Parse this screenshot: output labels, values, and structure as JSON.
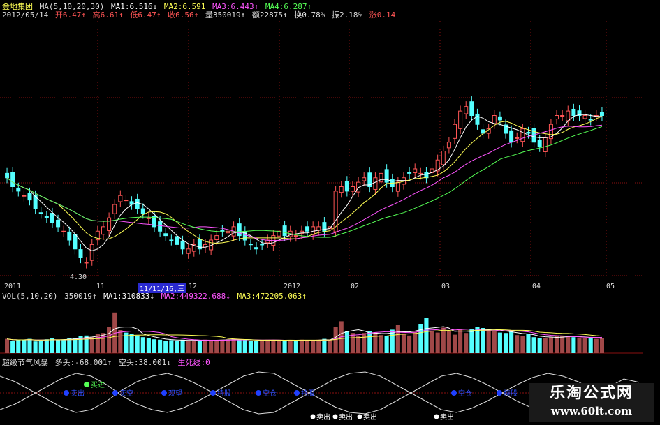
{
  "header": {
    "stock_name": "金地集团",
    "ma_label": "MA(5,10,20,30)",
    "ma1": "MA1:6.516↓",
    "ma2": "MA2:6.591",
    "ma3": "MA3:6.443↑",
    "ma4": "MA4:6.287↑",
    "date": "2012/05/14",
    "open": "开6.47↑",
    "high": "高6.61↑",
    "low": "低6.47↑",
    "close": "收6.56↑",
    "volume": "量350019↑",
    "amount": "额22875↑",
    "turnover": "换0.78%",
    "amplitude": "振2.18%",
    "change": "涨0.14"
  },
  "volume_header": {
    "label": "VOL(5,10,20)",
    "value": "350019↑",
    "ma1": "MA1:310833↓",
    "ma2": "MA2:449322.688↓",
    "ma3": "MA3:472205.063↑"
  },
  "indicator_header": {
    "name": "超级节气风暴",
    "long": "多头:-68.001↑",
    "short": "空头:38.001↓",
    "signal": "生死线:0"
  },
  "x_axis": {
    "labels": [
      "2011",
      "11",
      "11/11/16,三",
      "12",
      "2012",
      "02",
      "03",
      "04",
      "05"
    ]
  },
  "low_marker": "4.30",
  "signals": {
    "buy": [
      "买进"
    ],
    "sell": [
      "卖出",
      "卖出",
      "卖出",
      "卖出"
    ],
    "other": [
      "卖出",
      "卖空",
      "观望",
      "持股",
      "空仓",
      "持股",
      "空仓",
      "持股",
      "观望"
    ]
  },
  "watermark": {
    "line1": "乐淘公式网",
    "line2": "www.60lt.com"
  },
  "colors": {
    "up": "#ff5555",
    "down": "#54ffff",
    "ma1": "#ffffff",
    "ma2": "#ffff55",
    "ma3": "#ff55ff",
    "ma4": "#55ff55",
    "grid": "#8a1010"
  },
  "chart_data": [
    {
      "type": "candlestick",
      "title": "金地集团",
      "ylim": [
        4.0,
        8.0
      ],
      "close": [
        6.2,
        6.0,
        5.9,
        5.8,
        5.7,
        5.5,
        5.4,
        5.3,
        5.2,
        5.1,
        5.0,
        4.8,
        4.6,
        4.4,
        4.3,
        4.7,
        5.0,
        5.1,
        5.3,
        5.6,
        5.8,
        5.7,
        5.6,
        5.5,
        5.4,
        5.3,
        5.1,
        5.0,
        4.9,
        4.8,
        4.7,
        4.6,
        4.6,
        4.7,
        4.6,
        4.7,
        4.8,
        4.9,
        5.0,
        5.0,
        5.1,
        4.9,
        4.8,
        4.7,
        4.6,
        4.7,
        4.8,
        4.9,
        5.0,
        4.9,
        5.0,
        4.9,
        5.0,
        5.0,
        5.1,
        5.1,
        5.0,
        5.1,
        5.9,
        6.0,
        5.9,
        6.0,
        6.1,
        6.2,
        6.0,
        6.2,
        6.3,
        6.1,
        6.0,
        6.1,
        6.2,
        6.3,
        6.4,
        6.3,
        6.2,
        6.4,
        6.6,
        6.8,
        7.0,
        7.4,
        7.7,
        7.8,
        7.6,
        7.4,
        7.2,
        7.3,
        7.6,
        7.5,
        7.2,
        7.0,
        7.1,
        7.3,
        7.2,
        7.0,
        6.9,
        7.1,
        7.4,
        7.6,
        7.6,
        7.7,
        7.6,
        7.6,
        7.6,
        7.5,
        7.6,
        7.6
      ]
    },
    {
      "type": "bar",
      "title": "VOL(5,10,20)",
      "values": [
        3.4,
        3.0,
        3.1,
        3.2,
        3.4,
        2.8,
        3.0,
        3.3,
        3.5,
        3.1,
        3.2,
        3.5,
        3.6,
        4.1,
        4.2,
        3.8,
        4.5,
        4.8,
        6.3,
        9.7,
        5.5,
        4.9,
        4.6,
        4.2,
        3.8,
        3.5,
        3.3,
        3.2,
        3.0,
        3.1,
        3.0,
        3.2,
        2.9,
        3.0,
        3.1,
        3.2,
        3.1,
        3.0,
        3.2,
        3.3,
        3.4,
        3.2,
        3.1,
        3.0,
        2.9,
        3.0,
        3.2,
        3.1,
        3.0,
        2.9,
        3.1,
        3.0,
        3.2,
        3.1,
        3.0,
        3.2,
        3.4,
        3.1,
        6.2,
        7.6,
        5.2,
        4.8,
        4.1,
        4.8,
        5.3,
        4.9,
        4.3,
        4.0,
        5.6,
        6.8,
        4.7,
        4.2,
        5.1,
        7.0,
        8.4,
        5.3,
        4.9,
        6.1,
        5.2,
        4.4,
        5.6,
        4.8,
        5.7,
        6.3,
        6.0,
        5.4,
        5.2,
        4.9,
        4.8,
        5.2,
        4.3,
        4.1,
        4.5,
        3.8,
        3.5,
        3.6,
        3.8,
        4.0,
        4.2,
        4.0,
        3.8,
        3.7,
        3.6,
        3.5,
        3.4,
        3.5
      ]
    },
    {
      "type": "line",
      "title": "超级节气风暴",
      "series": [
        {
          "name": "多头",
          "values": [
            60,
            40,
            10,
            -20,
            -50,
            -70,
            -60,
            -30,
            10,
            40,
            60,
            70,
            55,
            30,
            0,
            -30,
            -60,
            -75,
            -70,
            -40,
            -10,
            20,
            50,
            70,
            75,
            60,
            30,
            0,
            -30,
            -60,
            -70,
            -55,
            -30,
            0,
            30,
            55,
            70,
            60,
            40,
            10,
            -20,
            -50,
            -68
          ]
        },
        {
          "name": "空头",
          "values": [
            -60,
            -40,
            -10,
            20,
            50,
            70,
            60,
            30,
            -10,
            -40,
            -60,
            -70,
            -55,
            -30,
            0,
            30,
            60,
            75,
            70,
            40,
            10,
            -20,
            -50,
            -70,
            -75,
            -60,
            -30,
            0,
            30,
            60,
            70,
            55,
            30,
            0,
            -30,
            -55,
            -70,
            -60,
            -40,
            -10,
            20,
            50,
            38
          ]
        }
      ]
    }
  ]
}
